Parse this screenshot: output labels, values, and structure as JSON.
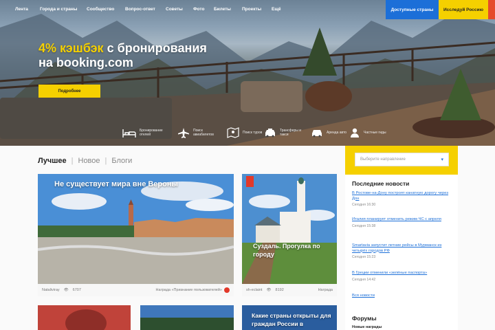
{
  "nav": {
    "items": [
      "Лента",
      "Города и страны",
      "Сообщество",
      "Вопрос-ответ",
      "Советы",
      "Фото",
      "Билеты",
      "Проекты",
      "Ещё"
    ],
    "button_available": "Доступные страны",
    "button_explore": "Исследуй Россию"
  },
  "hero": {
    "headline_accent": "4% кэшбэк",
    "headline_rest": " с бронирования",
    "headline_line2": "на booking.com",
    "cta": "Подробнее",
    "services": [
      {
        "icon": "bed-icon",
        "label": "Бронирование отелей"
      },
      {
        "icon": "plane-icon",
        "label": "Поиск авиабилетов"
      },
      {
        "icon": "map-pin-icon",
        "label": "Поиск туров"
      },
      {
        "icon": "taxi-icon",
        "label": "Трансферы и такси"
      },
      {
        "icon": "car-icon",
        "label": "Аренда авто"
      },
      {
        "icon": "person-icon",
        "label": "Частные гиды"
      }
    ]
  },
  "tabs": [
    "Лучшее",
    "Новое",
    "Блоги"
  ],
  "cards": [
    {
      "title": "Не существует мира вне Вероны",
      "author": "Nataliviray",
      "views": "6707",
      "award": "Награда «Признание пользователей»"
    },
    {
      "title": "Суздаль. Прогулка по городу",
      "author": "sh-eclaint",
      "views": "8192",
      "award": "Награда"
    },
    {
      "title": "Какие страны открыты для граждан России в"
    }
  ],
  "sidebar": {
    "select_placeholder": "Выберите направление",
    "news_title": "Последние новости",
    "news": [
      {
        "text": "В Ростове-на-Дону построят канатную дорогу через Дон",
        "date": "Сегодня 16:30"
      },
      {
        "text": "Италия планирует отменить режим ЧС с апреля",
        "date": "Сегодня 15:38"
      },
      {
        "text": "Smartavia запустит летние рейсы в Мурманск из четырёх городов РФ",
        "date": "Сегодня 15:23"
      },
      {
        "text": "В Греции отменили «зелёные паспорта»",
        "date": "Сегодня 14:42"
      }
    ],
    "all_news": "Вся новости",
    "forums_title": "Форумы",
    "forums_sub": "Новые награды"
  },
  "colors": {
    "accent_yellow": "#f5d000",
    "brand_blue": "#1c6fd8",
    "tag_red": "#e2392a"
  }
}
